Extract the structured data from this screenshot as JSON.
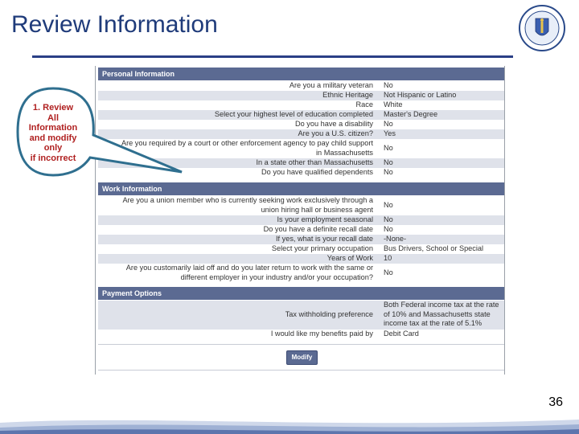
{
  "slide": {
    "title": "Review Information",
    "page_number": "36"
  },
  "callout": {
    "lines": [
      "1. Review",
      "All",
      "Information",
      "and modify",
      "only",
      "if incorrect"
    ]
  },
  "personal": {
    "header": "Personal Information",
    "rows": [
      {
        "q": "Are you a military veteran",
        "a": "No"
      },
      {
        "q": "Ethnic Heritage",
        "a": "Not Hispanic or Latino"
      },
      {
        "q": "Race",
        "a": "White"
      },
      {
        "q": "Select your highest level of education completed",
        "a": "Master's Degree"
      },
      {
        "q": "Do you have a disability",
        "a": "No"
      },
      {
        "q": "Are you a U.S. citizen?",
        "a": "Yes"
      },
      {
        "q": "Are you required by a court or other enforcement agency to pay child support in Massachusetts",
        "a": "No"
      },
      {
        "q": "In a state other than Massachusetts",
        "a": "No"
      },
      {
        "q": "Do you have qualified dependents",
        "a": "No"
      }
    ]
  },
  "work": {
    "header": "Work Information",
    "rows": [
      {
        "q": "Are you a union member who is currently seeking work exclusively through a union hiring hall or business agent",
        "a": "No"
      },
      {
        "q": "Is your employment seasonal",
        "a": "No"
      },
      {
        "q": "Do you have a definite recall date",
        "a": "No"
      },
      {
        "q": "If yes, what is your recall date",
        "a": "-None-"
      },
      {
        "q": "Select your primary occupation",
        "a": "Bus Drivers, School or Special"
      },
      {
        "q": "Years of Work",
        "a": "10"
      },
      {
        "q": "Are you customarily laid off and do you later return to work with the same or different employer in your industry and/or your occupation?",
        "a": "No"
      }
    ]
  },
  "payment": {
    "header": "Payment Options",
    "rows": [
      {
        "q": "Tax withholding preference",
        "a": "Both Federal income tax at the rate of 10% and Massachusetts state income tax at the rate of 5.1%"
      },
      {
        "q": "I would like my benefits paid by",
        "a": "Debit Card"
      }
    ]
  },
  "buttons": {
    "modify": "Modify"
  },
  "colors": {
    "title": "#1f3b7a",
    "header_bg": "#5b6a92",
    "callout_border": "#2f6f8f",
    "callout_text": "#b02020"
  }
}
